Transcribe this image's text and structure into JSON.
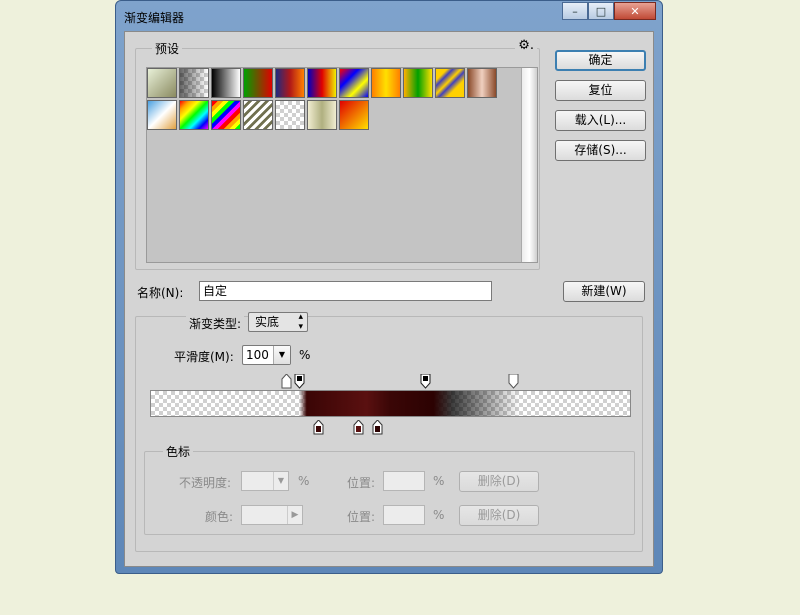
{
  "window": {
    "title": "渐变编辑器",
    "minimize": "–",
    "maximize": "□",
    "close": "✕"
  },
  "presets": {
    "legend": "预设",
    "gear_icon": "gear-icon",
    "row1": [
      "linear-gradient(135deg,#e8f0d8,#8a8a60)",
      "checker-fade",
      "linear-gradient(90deg,#000,#fff)",
      "linear-gradient(90deg,#00a000,#e00000)",
      "linear-gradient(90deg,#202a80,#b01818,#ff8000)",
      "linear-gradient(90deg,#0000c0,#e00000,#f0f000)",
      "linear-gradient(135deg,#ff0000,#0000ff,#ffff00,#0000ff)",
      "linear-gradient(90deg,#ff8000,#ffe000,#ff8000)",
      "linear-gradient(90deg,#ffb000,#00a000,#ffe000)",
      "linear-gradient(135deg,#ffd000 20%,#4040c0 30%,#ffd000 45%,#4040c0 55%,#ffd000 70%)",
      "linear-gradient(90deg,#8a4a2a,#f0d0c0,#8a4a2a)"
    ],
    "row2": [
      "linear-gradient(135deg,#4aa0e0,#fff 50%,#e0a040)",
      "linear-gradient(135deg,red,orange,yellow,lime,cyan,blue,magenta)",
      "repeating-linear-gradient(135deg,red 0 4px,orange 4px 8px,yellow 8px 12px,lime 12px 16px,blue 16px 20px,magenta 20px 24px)",
      "repeating-linear-gradient(135deg,#fff 0 3px,#707050 3px 6px)",
      "checker",
      "linear-gradient(90deg,#f0ecd0,#b0b080,#f0ecd0)",
      "linear-gradient(135deg,#e00000,#ffe000)"
    ]
  },
  "buttons": {
    "ok": "确定",
    "reset": "复位",
    "load": "载入(L)...",
    "save": "存储(S)...",
    "new": "新建(W)"
  },
  "name": {
    "label": "名称(N):",
    "value": "自定"
  },
  "gradient": {
    "type_label": "渐变类型:",
    "type_value": "实底",
    "smooth_label": "平滑度(M):",
    "smooth_value": "100",
    "smooth_unit": "%",
    "bar_colors": {
      "dark": "#3a0a0a",
      "red": "#5a0f0f"
    }
  },
  "stops": {
    "legend": "色标",
    "opacity_label": "不透明度:",
    "opacity_value": "",
    "opacity_unit": "%",
    "color_label": "颜色:",
    "position_label_1": "位置:",
    "position_unit_1": "%",
    "position_label_2": "位置:",
    "position_unit_2": "%",
    "delete_1": "删除(D)",
    "delete_2": "删除(D)"
  }
}
